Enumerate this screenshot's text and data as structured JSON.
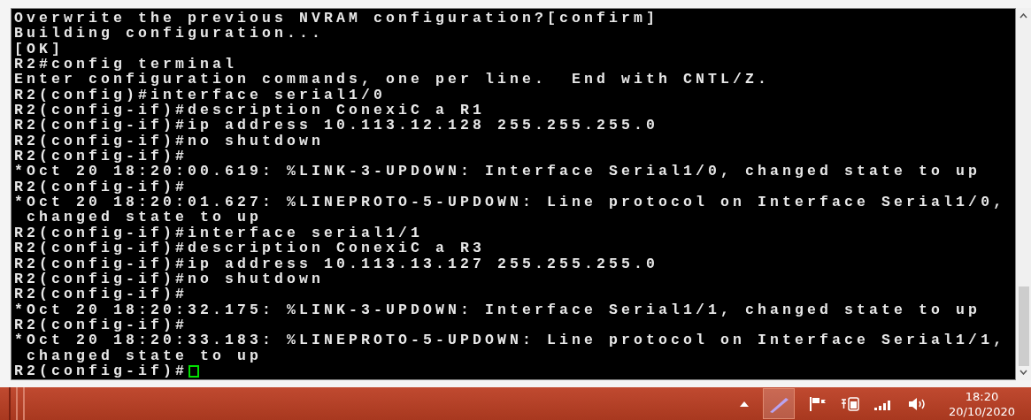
{
  "terminal": {
    "lines": [
      "Overwrite the previous NVRAM configuration?[confirm]",
      "Building configuration...",
      "[OK]",
      "R2#config terminal",
      "Enter configuration commands, one per line.  End with CNTL/Z.",
      "R2(config)#interface serial1/0",
      "R2(config-if)#description ConexiC a R1",
      "R2(config-if)#ip address 10.113.12.128 255.255.255.0",
      "R2(config-if)#no shutdown",
      "R2(config-if)#",
      "*Oct 20 18:20:00.619: %LINK-3-UPDOWN: Interface Serial1/0, changed state to up",
      "R2(config-if)#",
      "*Oct 20 18:20:01.627: %LINEPROTO-5-UPDOWN: Line protocol on Interface Serial1/0,",
      " changed state to up",
      "R2(config-if)#interface serial1/1",
      "R2(config-if)#description ConexiC a R3",
      "R2(config-if)#ip address 10.113.13.127 255.255.255.0",
      "R2(config-if)#no shutdown",
      "R2(config-if)#",
      "*Oct 20 18:20:32.175: %LINK-3-UPDOWN: Interface Serial1/1, changed state to up",
      "R2(config-if)#",
      "*Oct 20 18:20:33.183: %LINEPROTO-5-UPDOWN: Line protocol on Interface Serial1/1,",
      " changed state to up",
      "R2(config-if)#"
    ]
  },
  "taskbar": {
    "time": "18:20",
    "date": "20/10/2020"
  }
}
